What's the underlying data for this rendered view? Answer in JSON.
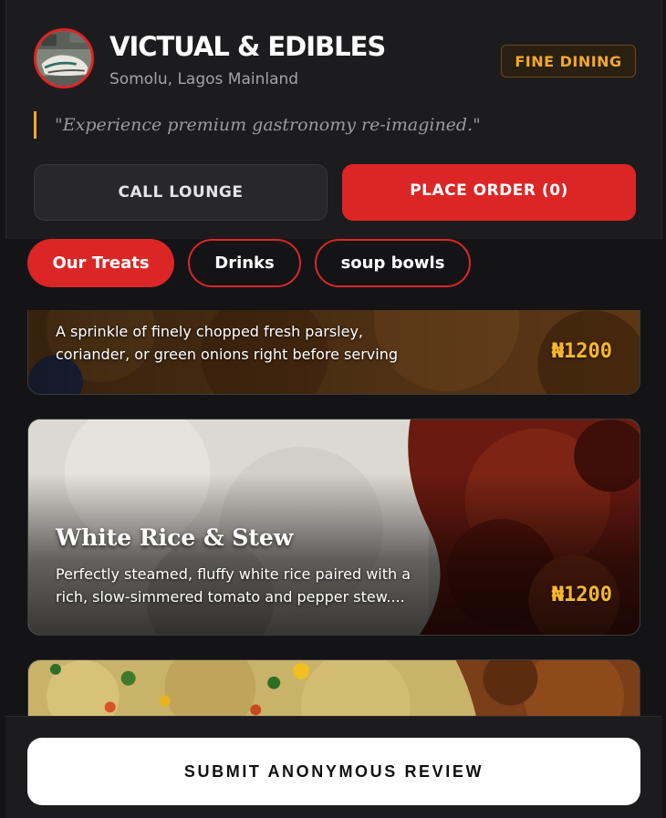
{
  "header": {
    "brand": "VICTUAL & EDIBLES",
    "location": "Somolu, Lagos Mainland",
    "badge": "FINE DINING",
    "tagline": "\"Experience premium gastronomy re-imagined.\"",
    "call_label": "CALL LOUNGE",
    "order_label": "PLACE ORDER (0)"
  },
  "tabs": [
    {
      "label": "Our Treats",
      "active": true
    },
    {
      "label": "Drinks",
      "active": false
    },
    {
      "label": "soup bowls",
      "active": false
    }
  ],
  "menu": {
    "items": [
      {
        "title": "",
        "description": "A sprinkle of finely chopped fresh parsley, coriander, or green onions right before serving",
        "price": "₦1200"
      },
      {
        "title": "White Rice & Stew",
        "description": "Perfectly steamed, fluffy white rice paired with a rich, slow-simmered tomato and pepper stew....",
        "price": "₦1200"
      }
    ]
  },
  "footer": {
    "review_label": "SUBMIT ANONYMOUS REVIEW"
  },
  "colors": {
    "accent": "#dc2626",
    "gold": "#f0a830",
    "background": "#141416"
  }
}
